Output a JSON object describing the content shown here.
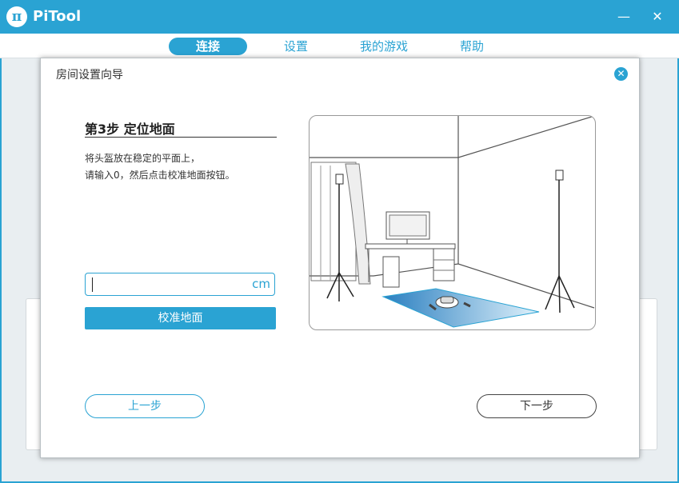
{
  "app": {
    "title": "PiTool",
    "logo_glyph": "π",
    "minimize_glyph": "—",
    "close_glyph": "✕"
  },
  "nav": {
    "tabs": [
      {
        "label": "连接",
        "active": true
      },
      {
        "label": "设置",
        "active": false
      },
      {
        "label": "我的游戏",
        "active": false
      },
      {
        "label": "帮助",
        "active": false
      }
    ]
  },
  "dialog": {
    "title": "房间设置向导",
    "close_glyph": "✕",
    "step_title": "第3步 定位地面",
    "instructions": [
      "将头盔放在稳定的平面上，",
      "请输入0，然后点击校准地面按钮。"
    ],
    "height_input": {
      "value": "",
      "unit": "cm"
    },
    "calibrate_label": "校准地面",
    "prev_label": "上一步",
    "next_label": "下一步"
  },
  "colors": {
    "accent": "#2aa3d3",
    "background": "#e9eef1",
    "text": "#333333"
  },
  "icons": [
    "pi-logo-icon",
    "minimize-icon",
    "close-icon",
    "dialog-close-icon"
  ]
}
